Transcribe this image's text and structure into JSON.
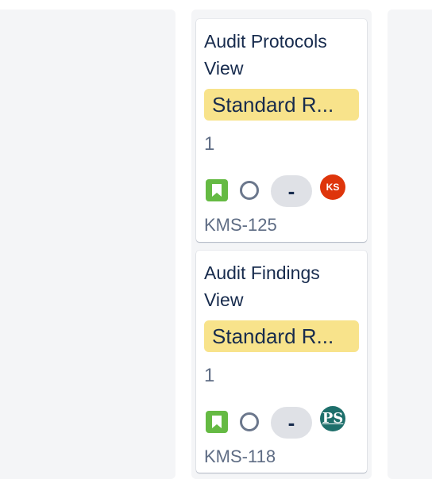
{
  "cards": [
    {
      "title": "Audit Protocols View",
      "epic": "Standard R...",
      "story_points": "1",
      "priority": "-",
      "assignee_initials": "KS",
      "assignee_color": "#de350b",
      "key": "KMS-125"
    },
    {
      "title": "Audit Findings View",
      "epic": "Standard R...",
      "story_points": "1",
      "priority": "-",
      "assignee_initials": "PS",
      "assignee_color": "#1e6f6b",
      "key": "KMS-118"
    }
  ],
  "colors": {
    "epic_label": "#f8e38b",
    "story_icon": "#65ba43",
    "column_bg": "#f4f5f7"
  }
}
